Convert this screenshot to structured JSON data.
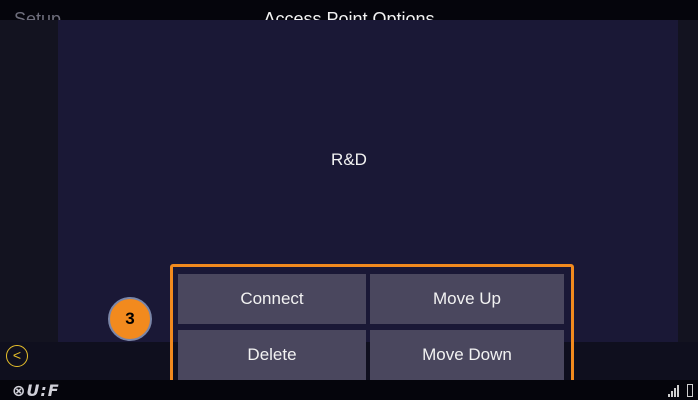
{
  "header": {
    "back_label": "Setup",
    "title": "Access Point Options"
  },
  "network": {
    "ssid": "R&D"
  },
  "actions": {
    "connect": "Connect",
    "move_up": "Move Up",
    "delete": "Delete",
    "move_down": "Move Down"
  },
  "callout": {
    "step": "3"
  },
  "footer": {
    "logo_text": "⊗U:F"
  },
  "colors": {
    "accent": "#f28a1e",
    "button_bg": "#4a475e",
    "panel_bg": "#1a1836",
    "back_icon": "#e8c02a"
  },
  "icons": [
    "back-arrow-icon",
    "signal-icon",
    "battery-icon"
  ]
}
